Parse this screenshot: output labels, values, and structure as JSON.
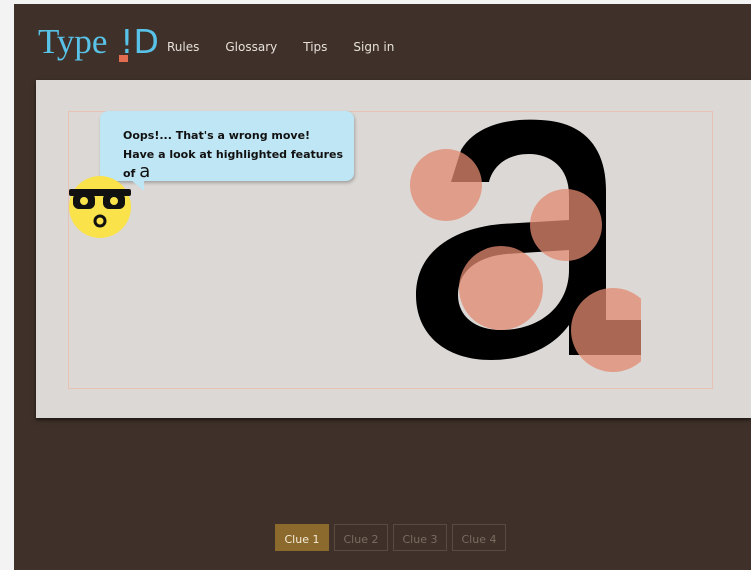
{
  "header": {
    "logo_text": "Type",
    "logo_mark": "!D",
    "nav": [
      "Rules",
      "Glossary",
      "Tips",
      "Sign in"
    ]
  },
  "feedback": {
    "line1": "Oops!... That's a wrong move!",
    "line2": "Have a look at highlighted features of",
    "glyph_inline": "a"
  },
  "specimen": {
    "glyph": "a",
    "highlight_color": "#e28a70"
  },
  "clues": [
    {
      "label": "Clue 1",
      "active": true
    },
    {
      "label": "Clue 2",
      "active": false
    },
    {
      "label": "Clue 3",
      "active": false
    },
    {
      "label": "Clue 4",
      "active": false
    }
  ],
  "colors": {
    "background": "#3f3129",
    "accent": "#59c2e8",
    "active_clue": "#8c6a2e"
  }
}
